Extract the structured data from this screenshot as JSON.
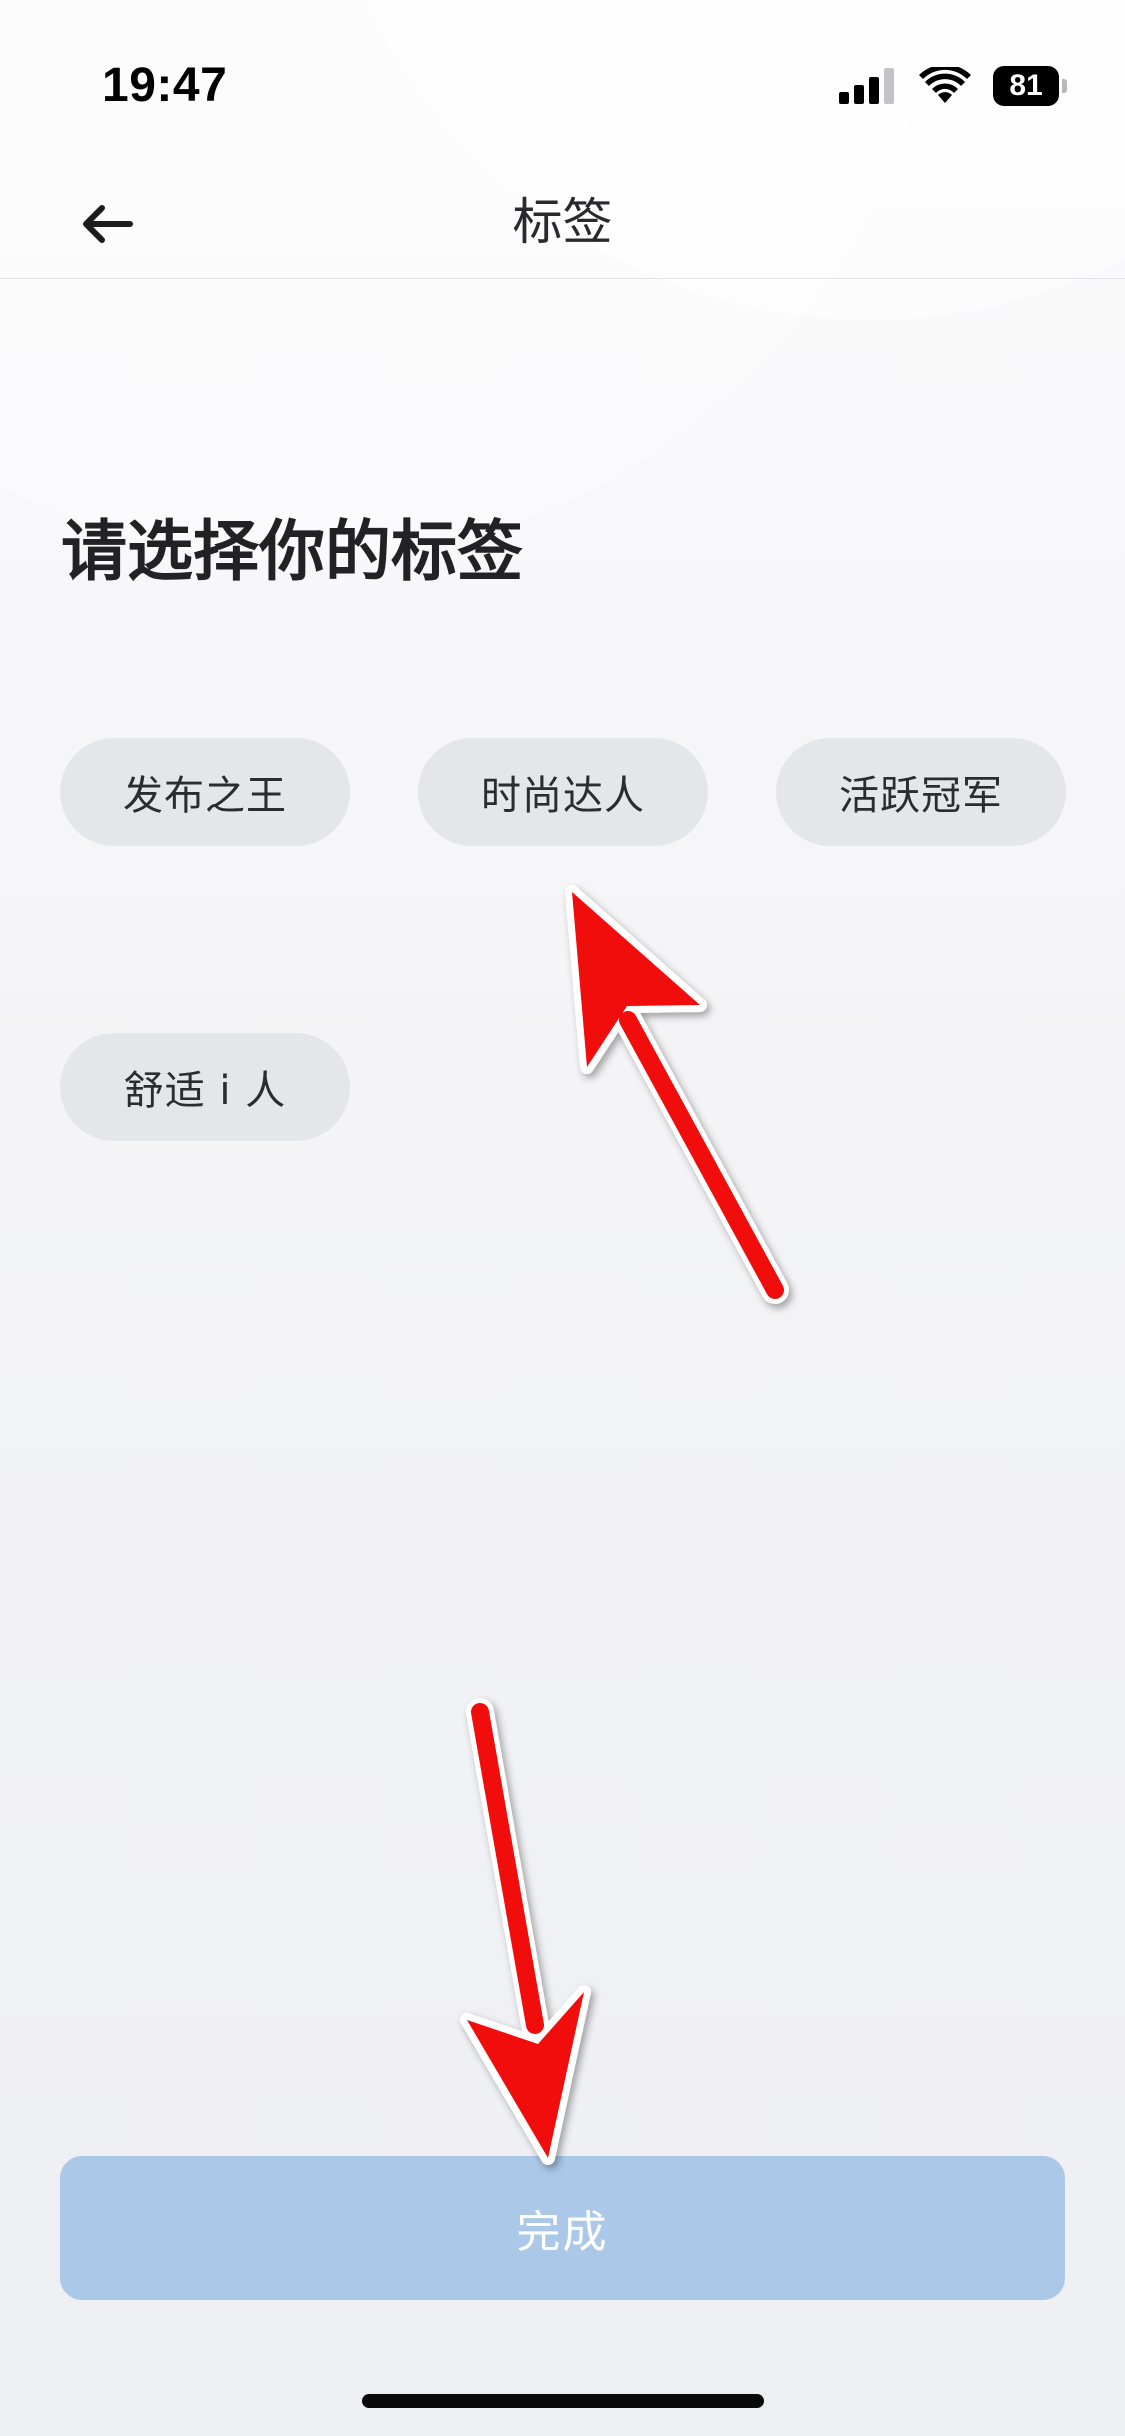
{
  "status_bar": {
    "time": "19:47",
    "battery": "81",
    "icons": [
      "cellular-signal-icon",
      "wifi-icon",
      "battery-icon"
    ]
  },
  "nav": {
    "title": "标签",
    "back_icon": "arrow-left-icon"
  },
  "heading": "请选择你的标签",
  "tags": [
    {
      "label": "发布之王"
    },
    {
      "label": "时尚达人"
    },
    {
      "label": "活跃冠军"
    },
    {
      "label": "舒适 i 人"
    }
  ],
  "done_button": {
    "label": "完成"
  },
  "colors": {
    "chip_bg": "#e5e6ea",
    "done_bg": "#abc8e8",
    "annotation_arrow": "#f2070b"
  }
}
